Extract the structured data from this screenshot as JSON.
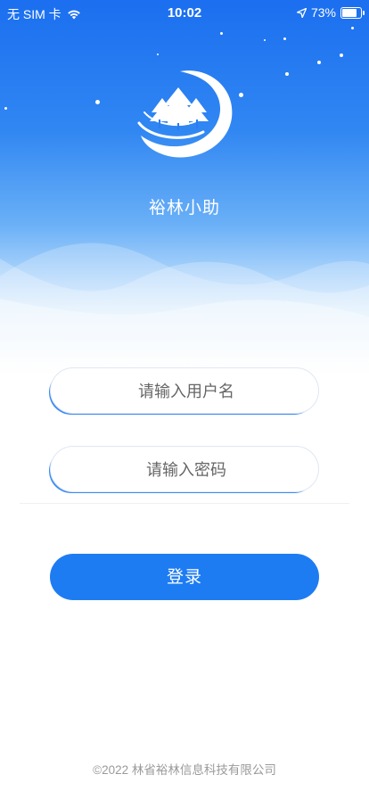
{
  "status_bar": {
    "carrier": "无 SIM 卡",
    "time": "10:02",
    "battery": "73%",
    "icons": [
      "wifi-icon",
      "location-arrow-icon",
      "battery-icon"
    ]
  },
  "header": {
    "app_name": "裕林小助",
    "logo": "forest-moon-logo"
  },
  "form": {
    "username_placeholder": "请输入用户名",
    "username_value": "",
    "password_placeholder": "请输入密码",
    "password_value": "",
    "login_label": "登录"
  },
  "footer": {
    "copyright": "©2022 林省裕林信息科技有限公司"
  },
  "colors": {
    "primary": "#1e7cf2",
    "hero_top": "#1b6ff0",
    "text_muted": "#9a9a9a"
  }
}
